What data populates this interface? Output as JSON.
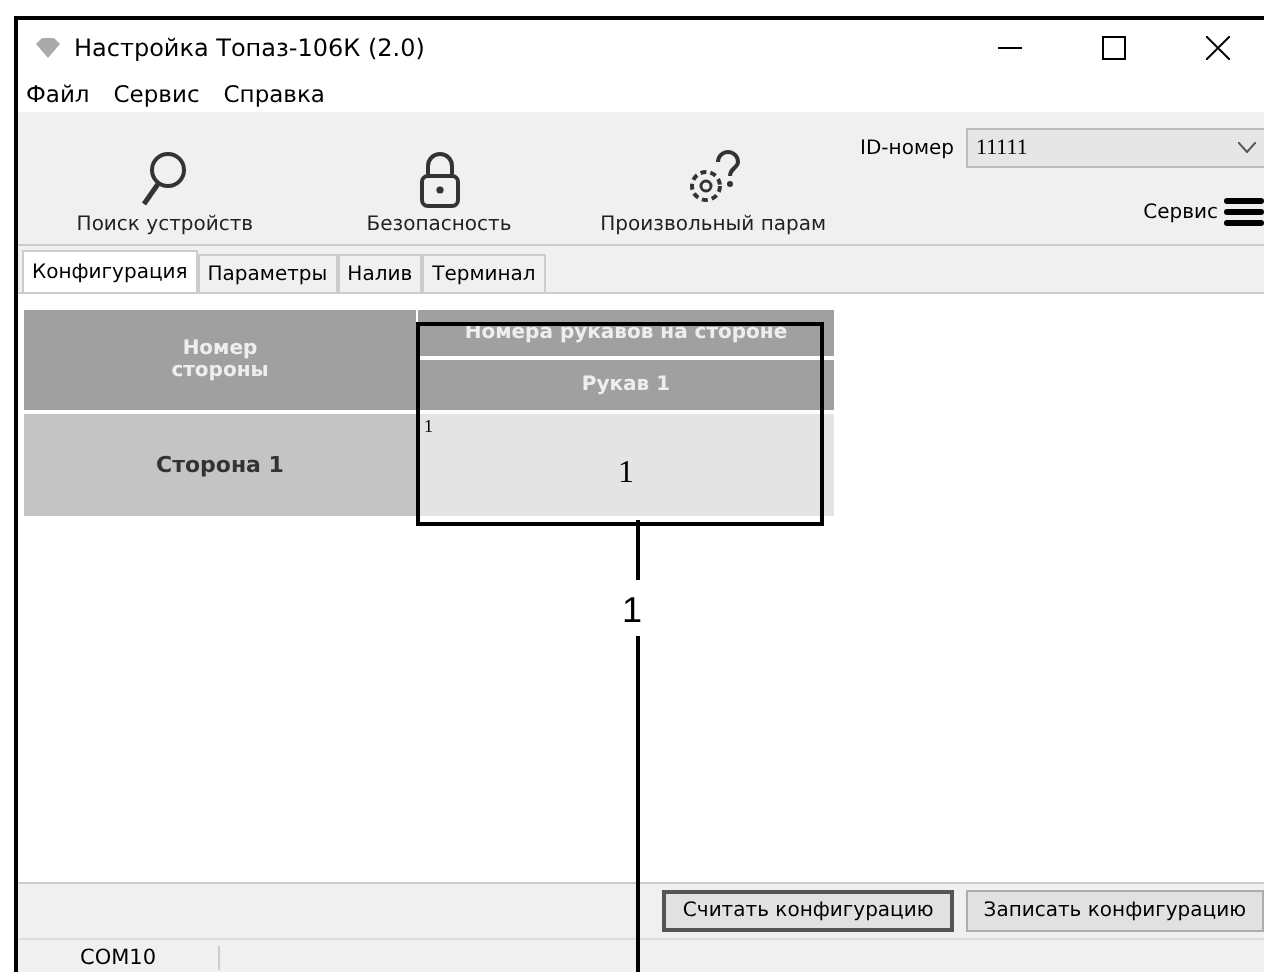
{
  "window": {
    "title": "Настройка Топаз-106К (2.0)"
  },
  "menu": [
    "Файл",
    "Сервис",
    "Справка"
  ],
  "toolbar": {
    "buttons": [
      {
        "kind": "search",
        "label": "Поиск устройств"
      },
      {
        "kind": "lock",
        "label": "Безопасность"
      },
      {
        "kind": "gear",
        "label": "Произвольный парам"
      }
    ],
    "id_label": "ID-номер",
    "id_value": "11111",
    "service_label": "Сервис"
  },
  "tabs": [
    {
      "label": "Конфигурация",
      "selected": true
    },
    {
      "label": "Параметры",
      "selected": false
    },
    {
      "label": "Налив",
      "selected": false
    },
    {
      "label": "Терминал",
      "selected": false
    }
  ],
  "table": {
    "side_header": "Номер\nстороны",
    "group_header": "Номера рукавов на стороне",
    "columns": [
      "Рукав 1"
    ],
    "rows": [
      {
        "side": "Сторона 1",
        "cells": [
          {
            "index": "1",
            "value": "1"
          }
        ]
      }
    ]
  },
  "buttons": [
    {
      "label": "Считать конфигурацию",
      "selected": true
    },
    {
      "label": "Записать конфигурацию",
      "selected": false
    }
  ],
  "status_bar": "COM10",
  "callout": {
    "label": "1"
  }
}
